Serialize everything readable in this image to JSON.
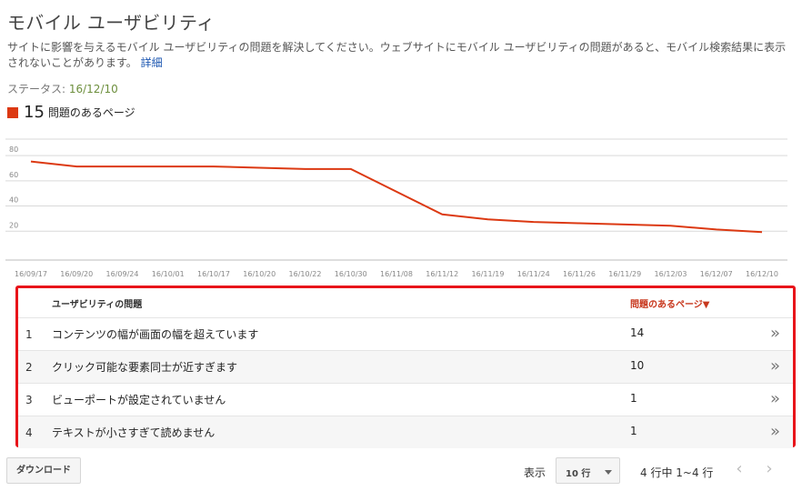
{
  "header": {
    "title": "モバイル ユーザビリティ",
    "description": "サイトに影響を与えるモバイル ユーザビリティの問題を解決してください。ウェブサイトにモバイル ユーザビリティの問題があると、モバイル検索結果に表示されないことがあります。",
    "details_link": "詳細",
    "status_label": "ステータス: ",
    "status_date": "16/12/10"
  },
  "metric": {
    "count": "15",
    "label": "問題のあるページ",
    "color": "#dc3912"
  },
  "chart_data": {
    "type": "line",
    "x": [
      "16/09/17",
      "16/09/20",
      "16/09/24",
      "16/10/01",
      "16/10/17",
      "16/10/20",
      "16/10/22",
      "16/10/30",
      "16/11/08",
      "16/11/12",
      "16/11/19",
      "16/11/24",
      "16/11/26",
      "16/11/29",
      "16/12/03",
      "16/12/07",
      "16/12/10"
    ],
    "series": [
      {
        "values": [
          71,
          67,
          67,
          67,
          67,
          66,
          65,
          65,
          null,
          29,
          25,
          23,
          22,
          21,
          20,
          17,
          15
        ],
        "color": "#dc3912"
      }
    ],
    "yticks": [
      20,
      40,
      60,
      80
    ],
    "ylim": [
      0,
      88
    ],
    "grid": true,
    "title": "",
    "xlabel": "",
    "ylabel": ""
  },
  "table": {
    "col_issue": "ユーザビリティの問題",
    "col_pages": "問題のあるページ▼",
    "rows": [
      {
        "num": "1",
        "issue": "コンテンツの幅が画面の幅を超えています",
        "pages": "14"
      },
      {
        "num": "2",
        "issue": "クリック可能な要素同士が近すぎます",
        "pages": "10"
      },
      {
        "num": "3",
        "issue": "ビューポートが設定されていません",
        "pages": "1"
      },
      {
        "num": "4",
        "issue": "テキストが小さすぎて読めません",
        "pages": "1"
      }
    ],
    "row_chevron": "»"
  },
  "footer": {
    "download_label": "ダウンロード",
    "show_label": "表示",
    "rows_per_page": "10 行",
    "pager_text": "4 行中 1~4 行",
    "prev_icon": "‹",
    "next_icon": "›"
  }
}
